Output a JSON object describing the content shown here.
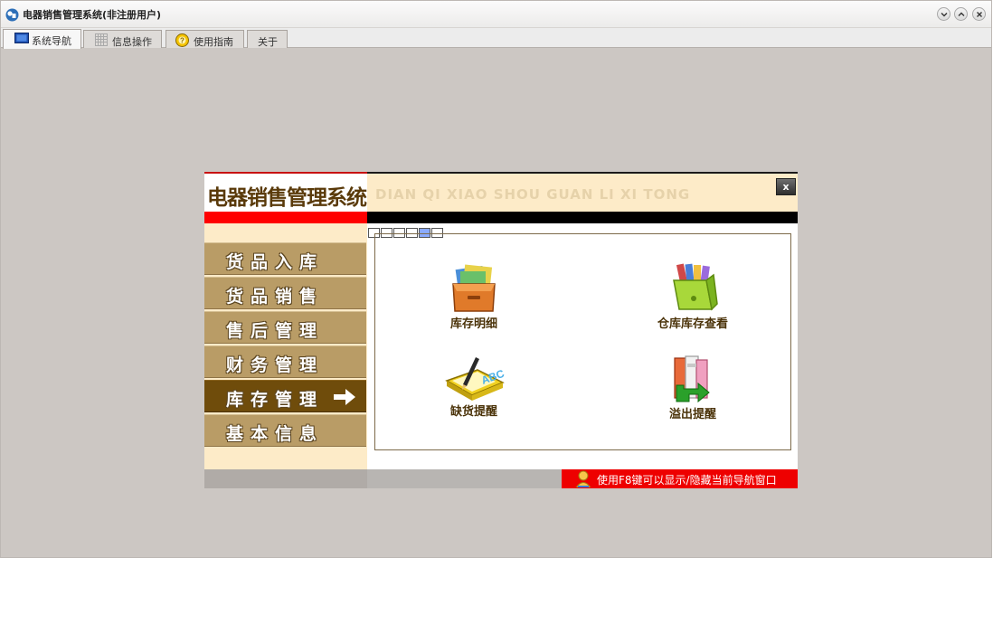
{
  "window": {
    "title": "电器销售管理系统(非注册用户)",
    "controls": [
      "minimize",
      "maximize",
      "close"
    ]
  },
  "tabs": [
    {
      "label": "系统导航",
      "icon": "monitor-icon",
      "active": true
    },
    {
      "label": "信息操作",
      "icon": "grid-icon",
      "active": false
    },
    {
      "label": "使用指南",
      "icon": "help-icon",
      "active": false
    },
    {
      "label": "关于",
      "icon": "",
      "active": false
    }
  ],
  "nav_panel": {
    "title": "电器销售管理系统",
    "pinyin": "DIAN QI XIAO SHOU GUAN LI XI TONG",
    "close_label": "x",
    "menu": [
      {
        "label": "货品入库",
        "active": false
      },
      {
        "label": "货品销售",
        "active": false
      },
      {
        "label": "售后管理",
        "active": false
      },
      {
        "label": "财务管理",
        "active": false
      },
      {
        "label": "库存管理",
        "active": true
      },
      {
        "label": "基本信息",
        "active": false
      }
    ],
    "pages": {
      "count": 6,
      "current": 5
    },
    "functions": [
      {
        "label": "库存明细",
        "icon": "folder-box-icon"
      },
      {
        "label": "仓库库存查看",
        "icon": "book-folder-icon"
      },
      {
        "label": "缺货提醒",
        "icon": "notebook-pen-icon"
      },
      {
        "label": "溢出提醒",
        "icon": "books-arrow-icon"
      }
    ],
    "tip": "使用F8键可以显示/隐藏当前导航窗口"
  },
  "colors": {
    "desktop": "#ccc7c3",
    "menu": "#b99c66",
    "menu_active": "#6f4c0b",
    "header_band": "#fdebc8",
    "red_band": "#ff0000",
    "tip_bar": "#ee0000"
  }
}
